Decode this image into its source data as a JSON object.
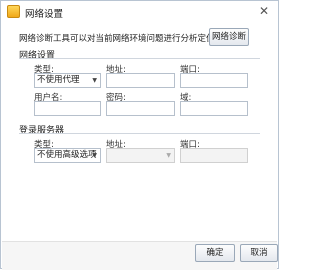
{
  "window": {
    "title": "网络设置"
  },
  "description": "网络诊断工具可以对当前网络环境问题进行分析定位。",
  "diagnose_button": "网络诊断",
  "network_settings": {
    "section_title": "网络设置",
    "type_label": "类型:",
    "type_value": "不使用代理",
    "address_label": "地址:",
    "address_value": "",
    "port_label": "端口:",
    "port_value": "",
    "username_label": "用户名:",
    "username_value": "",
    "password_label": "密码:",
    "password_value": "",
    "domain_label": "域:",
    "domain_value": ""
  },
  "login_server": {
    "section_title": "登录服务器",
    "type_label": "类型:",
    "type_value": "不使用高级选项",
    "address_label": "地址:",
    "address_value": "",
    "port_label": "端口:",
    "port_value": ""
  },
  "footer": {
    "ok_label": "确定",
    "cancel_label": "取消"
  },
  "icons": {
    "app": "app-icon",
    "close": "close-icon",
    "dropdown": "chevron-down-icon"
  }
}
